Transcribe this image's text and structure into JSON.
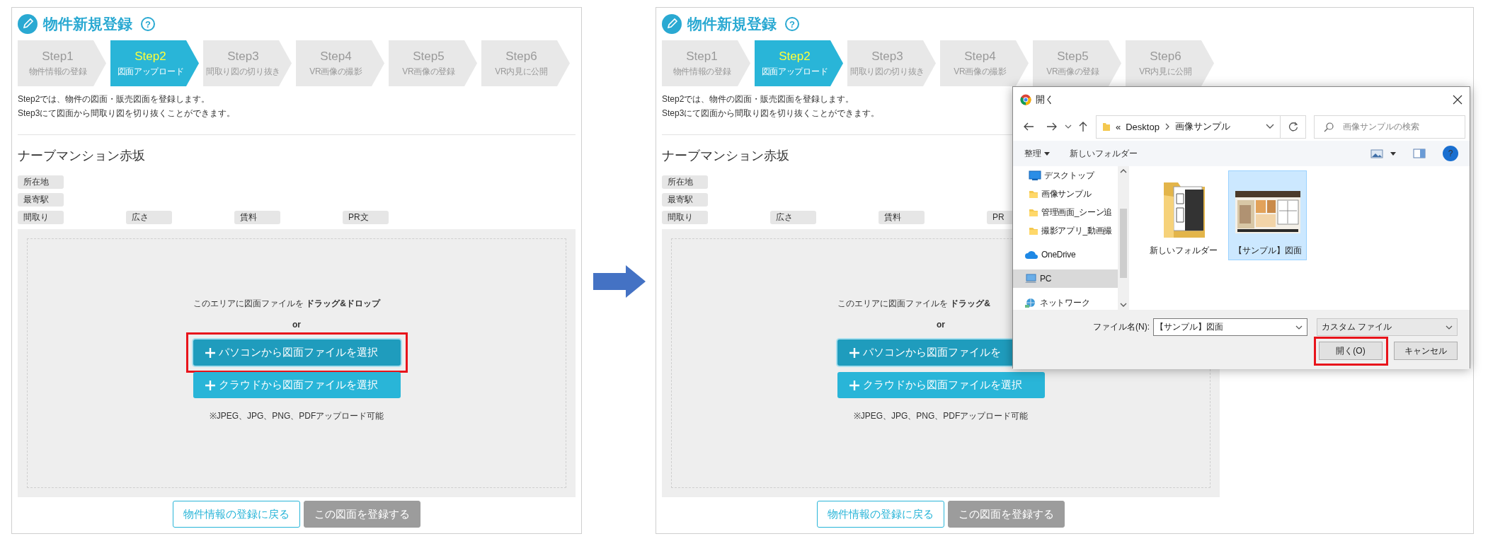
{
  "panels": [
    {
      "title": "物件新規登録",
      "help": "?",
      "steps": [
        {
          "label": "Step1",
          "caption": "物件情報の登録",
          "selected": false
        },
        {
          "label": "Step2",
          "caption": "図面アップロード",
          "selected": true
        },
        {
          "label": "Step3",
          "caption": "間取り図の切り抜き",
          "selected": false
        },
        {
          "label": "Step4",
          "caption": "VR画像の撮影",
          "selected": false
        },
        {
          "label": "Step5",
          "caption": "VR画像の登録",
          "selected": false
        },
        {
          "label": "Step6",
          "caption": "VR内見に公開",
          "selected": false
        }
      ],
      "description": [
        "Step2では、物件の図面・販売図面を登録します。",
        "Step3にて図面から間取り図を切り抜くことができます。"
      ],
      "property_name": "ナーブマンション赤坂",
      "tag_rows": [
        [
          "所在地"
        ],
        [
          "最寄駅"
        ],
        [
          "間取り",
          "広さ",
          "賃料",
          "PR文"
        ]
      ],
      "drop_zone": {
        "message": "このエリアに図面ファイルを **ドラッグ&ドロップ**",
        "separator": "or",
        "buttons": [
          {
            "label": "パソコンから図面ファイルを選択",
            "hovered": true,
            "callout": true
          },
          {
            "label": "クラウドから図面ファイルを選択",
            "hovered": false,
            "callout": false
          }
        ],
        "note": "※JPEG、JPG、PNG、PDFアップロード可能"
      },
      "footer_buttons": [
        {
          "label": "物件情報の登録に戻る",
          "disabled": false
        },
        {
          "label": "この図面を登録する",
          "disabled": true
        }
      ]
    },
    {
      "title": "物件新規登録",
      "help": "?",
      "steps": [
        {
          "label": "Step1",
          "caption": "物件情報の登録",
          "selected": false
        },
        {
          "label": "Step2",
          "caption": "図面アップロード",
          "selected": true
        },
        {
          "label": "Step3",
          "caption": "間取り図の切り抜き",
          "selected": false
        },
        {
          "label": "Step4",
          "caption": "VR画像の撮影",
          "selected": false
        },
        {
          "label": "Step5",
          "caption": "VR画像の登録",
          "selected": false
        },
        {
          "label": "Step6",
          "caption": "VR内見に公開",
          "selected": false
        }
      ],
      "description": [
        "Step2では、物件の図面・販売図面を登録します。",
        "Step3にて図面から間取り図を切り抜くことができます。"
      ],
      "property_name": "ナーブマンション赤坂",
      "tag_rows": [
        [
          "所在地"
        ],
        [
          "最寄駅"
        ],
        [
          "間取り",
          "広さ",
          "賃料",
          "PR"
        ]
      ],
      "drop_zone": {
        "message": "このエリアに図面ファイルを **ドラッグ&**",
        "separator": "or",
        "buttons": [
          {
            "label": "パソコンから図面ファイルを",
            "hovered": true,
            "callout": false
          },
          {
            "label": "クラウドから図面ファイルを選択",
            "hovered": false,
            "callout": false
          }
        ],
        "note": "※JPEG、JPG、PNG、PDFアップロード可能"
      },
      "footer_buttons": [
        {
          "label": "物件情報の登録に戻る",
          "disabled": false
        },
        {
          "label": "この図面を登録する",
          "disabled": true
        }
      ]
    }
  ],
  "dialog": {
    "title": "開く",
    "address": {
      "prefix": "«",
      "path": [
        "Desktop",
        "画像サンプル"
      ]
    },
    "search": {
      "placeholder": "画像サンプルの検索"
    },
    "toolbar": {
      "organize": "整理",
      "new_folder": "新しいフォルダー",
      "help": "?"
    },
    "nav_items": [
      {
        "label": "デスクトップ",
        "kind": "desktop",
        "selected": false
      },
      {
        "label": "画像サンプル",
        "kind": "folder",
        "selected": false
      },
      {
        "label": "管理画面_シーン追",
        "kind": "folder",
        "selected": false
      },
      {
        "label": "撮影アプリ_動画撮",
        "kind": "folder",
        "selected": false
      },
      {
        "label": "OneDrive",
        "kind": "cloud",
        "selected": false
      },
      {
        "label": "PC",
        "kind": "pc",
        "selected": true
      },
      {
        "label": "ネットワーク",
        "kind": "network",
        "selected": false
      }
    ],
    "files": [
      {
        "name": "新しいフォルダー",
        "kind": "folder",
        "selected": false
      },
      {
        "name": "【サンプル】図面",
        "selected": true
      }
    ],
    "filename_label": "ファイル名(N):",
    "filename": "【サンプル】図面",
    "file_type": "カスタム ファイル",
    "buttons": [
      {
        "label": "開く(O)",
        "callout": true
      },
      {
        "label": "キャンセル",
        "callout": false
      }
    ]
  }
}
